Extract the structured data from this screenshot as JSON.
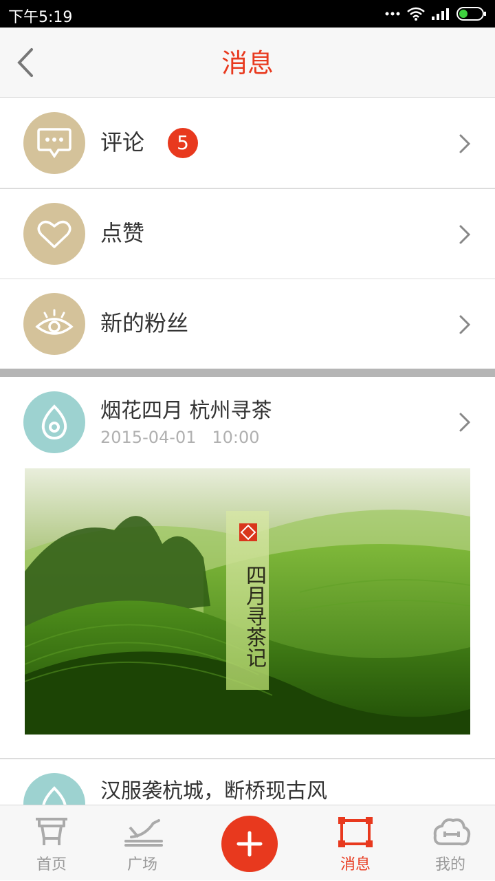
{
  "status_bar": {
    "time": "下午5:19"
  },
  "header": {
    "title": "消息",
    "back_icon": "chevron-left-icon"
  },
  "menu": [
    {
      "label": "评论",
      "badge": "5",
      "icon": "chat-bubble-icon"
    },
    {
      "label": "点赞",
      "icon": "heart-icon"
    },
    {
      "label": "新的粉丝",
      "icon": "eye-icon"
    }
  ],
  "posts": [
    {
      "title": "烟花四月  杭州寻茶",
      "date": "2015-04-01",
      "time": "10:00",
      "image_caption": "四月寻茶记"
    },
    {
      "title": "汉服袭杭城，断桥现古风"
    }
  ],
  "tabbar": {
    "items": [
      {
        "label": "首页",
        "icon": "cart-icon"
      },
      {
        "label": "广场",
        "icon": "plaza-icon"
      },
      {
        "label": "",
        "icon": "plus-icon"
      },
      {
        "label": "消息",
        "icon": "message-frame-icon"
      },
      {
        "label": "我的",
        "icon": "cloud-profile-icon"
      }
    ],
    "active": "消息"
  },
  "colors": {
    "accent": "#e8391e",
    "icon_circle": "#d4c29a",
    "post_circle": "#9dd2d0"
  }
}
